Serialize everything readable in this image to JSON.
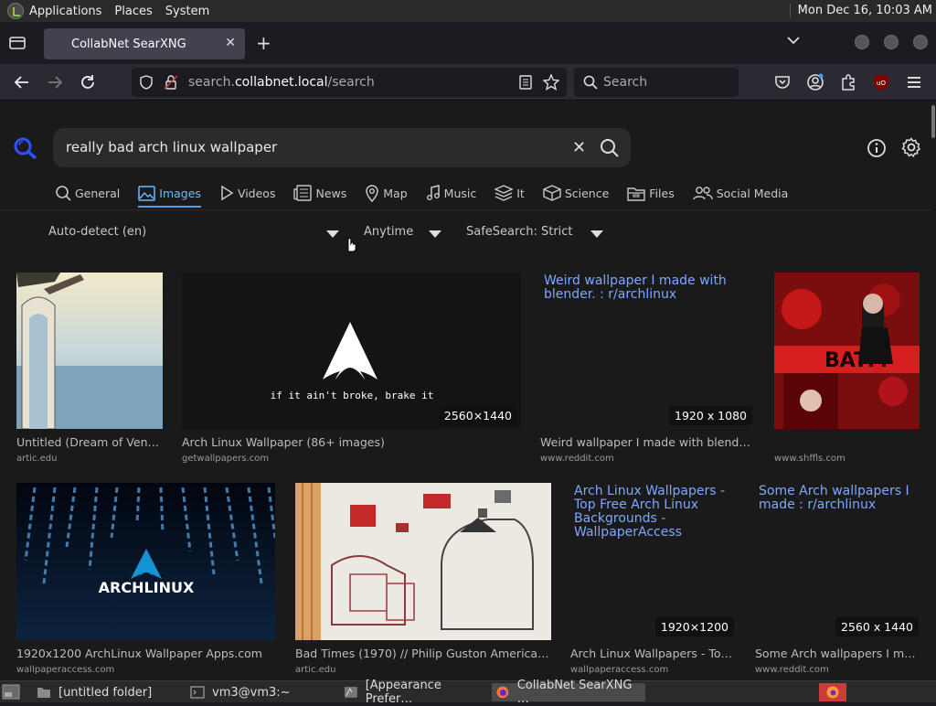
{
  "top_panel": {
    "menus": [
      "Applications",
      "Places",
      "System"
    ],
    "clock": "Mon Dec 16, 10:03 AM"
  },
  "browser": {
    "tab_title": "CollabNet SearXNG",
    "url_prefix": "search.",
    "url_host": "collabnet.local",
    "url_path": "/search",
    "search_placeholder": "Search"
  },
  "search": {
    "query": "really bad arch linux wallpaper",
    "categories": [
      {
        "label": "General",
        "icon": "search-icon"
      },
      {
        "label": "Images",
        "icon": "image-icon",
        "active": true
      },
      {
        "label": "Videos",
        "icon": "play-icon"
      },
      {
        "label": "News",
        "icon": "newspaper-icon"
      },
      {
        "label": "Map",
        "icon": "map-pin-icon"
      },
      {
        "label": "Music",
        "icon": "music-note-icon"
      },
      {
        "label": "It",
        "icon": "layers-icon"
      },
      {
        "label": "Science",
        "icon": "cube-icon"
      },
      {
        "label": "Files",
        "icon": "folder-icon"
      },
      {
        "label": "Social Media",
        "icon": "people-icon"
      }
    ],
    "filters": {
      "language": "Auto-detect (en)",
      "time": "Anytime",
      "safesearch": "SafeSearch: Strict"
    }
  },
  "results": [
    {
      "title": "Untitled (Dream of Venus…",
      "source": "artic.edu",
      "resolution": "",
      "alt": ""
    },
    {
      "title": "Arch Linux Wallpaper (86+ images)",
      "source": "getwallpapers.com",
      "resolution": "2560×1440",
      "alt": "",
      "image_text": "if it ain't broke, brake it"
    },
    {
      "title": "Weird wallpaper I made with blender. : …",
      "source": "www.reddit.com",
      "resolution": "1920 x 1080",
      "alt": "Weird wallpaper I made with blender. : r/archlinux"
    },
    {
      "title": "",
      "source": "www.shffls.com",
      "resolution": "",
      "alt": ""
    },
    {
      "title": "1920x1200 ArchLinux Wallpaper Apps.com",
      "source": "wallpaperaccess.com",
      "resolution": "",
      "alt": "",
      "image_text": "ARCHLINUX"
    },
    {
      "title": "Bad Times (1970) // Philip Guston American, …",
      "source": "artic.edu",
      "resolution": "",
      "alt": ""
    },
    {
      "title": "Arch Linux Wallpapers - Top …",
      "source": "wallpaperaccess.com",
      "resolution": "1920×1200",
      "alt": "Arch Linux Wallpapers - Top Free Arch Linux Backgrounds - WallpaperAccess"
    },
    {
      "title": "Some Arch wallpapers I mad…",
      "source": "www.reddit.com",
      "resolution": "2560 x 1440",
      "alt": "Some Arch wallpapers I made : r/archlinux"
    }
  ],
  "taskbar": {
    "tasks": [
      "[untitled folder]",
      "vm3@vm3:~",
      "[Appearance Prefer…",
      "CollabNet SearXNG …"
    ]
  }
}
